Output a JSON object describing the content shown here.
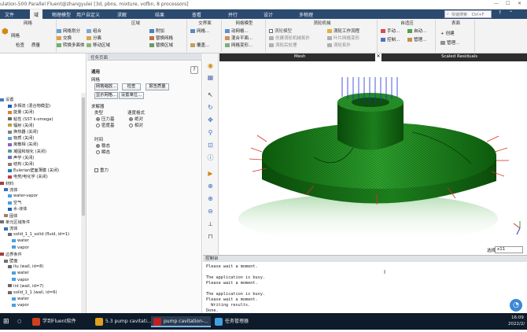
{
  "window": {
    "title": "ulation-500 Parallel Fluent@zhangyulei [3d, pbns, mixture, vofbn, 8 processors]"
  },
  "ribbon_tabs": [
    "文件",
    "域",
    "物理模型",
    "用户自定义",
    "求解",
    "结果",
    "查看",
    "并行",
    "设计",
    "多物理"
  ],
  "ribbon_tab_active": "域",
  "ribbon_search": {
    "placeholder": "快速搜索",
    "shortcut": "Ctrl+F"
  },
  "ribbon_groups": [
    {
      "title": "网格",
      "items": [
        "网格",
        "检查",
        "质量",
        "网格划分",
        "交换",
        "转换多面体"
      ]
    },
    {
      "title": "区域",
      "items": [
        "组合",
        "分离",
        "附加",
        "删除",
        "移动区域",
        "修改区域"
      ]
    },
    {
      "title": "区域",
      "items": [
        "附加",
        "替换网格",
        "替换区域",
        "删除"
      ]
    },
    {
      "title": "交界面",
      "items": [
        "网格...",
        "覆盖..."
      ]
    },
    {
      "title": "网格模型",
      "items": [
        "动网格...",
        "混合平面...",
        "网格变形..."
      ]
    },
    {
      "title": "涡轮机械",
      "items": [
        "涡轮模型",
        "创建涡轮机械拓扑",
        "涡轮后处理",
        "涡轮工作流程",
        "叶片网格变形",
        "涡轮拓扑"
      ]
    },
    {
      "title": "自适应",
      "items": [
        "手动...",
        "自动...",
        "控制...",
        "管理..."
      ]
    },
    {
      "title": "表面",
      "items": [
        "创建",
        "管理..."
      ]
    }
  ],
  "tree": [
    "设置",
    "多相流 (混合物模型)",
    "能量 (关闭)",
    "粘性 (SST k-omega)",
    "辐射 (关闭)",
    "换热器 (关闭)",
    "物质 (关闭)",
    "离散相 (关闭)",
    "凝固和熔化 (关闭)",
    "声学 (关闭)",
    "结构 (关闭)",
    "Eulerian壁面薄膜 (关闭)",
    "电势/电化学 (关闭)",
    "材料",
    "流体",
    "water-vapor",
    "空气",
    "水-液体",
    "固体",
    "单元区域条件",
    "流体",
    "solid_1_1_solid (fluid, id=1)",
    "water",
    "vapor",
    "边界条件",
    "壁面",
    "itu (wall, id=8)",
    "water",
    "vapor",
    "int (wall, id=7)",
    "solid_1_1 (wall, id=6)",
    "water",
    "vapor"
  ],
  "task_page": {
    "header": "任务页面",
    "section_general": "通用",
    "grid_label": "网格",
    "grid_buttons": [
      "网格缩放...",
      "检查",
      "报告质量",
      "显示网格...",
      "设置单位..."
    ],
    "solver_label": "求解器",
    "type_label": "类型",
    "type_options": [
      "压力基",
      "密度基"
    ],
    "type_selected": "压力基",
    "velocity_label": "速度格式",
    "velocity_options": [
      "绝对",
      "相对"
    ],
    "velocity_selected": "绝对",
    "time_label": "时间",
    "time_options": [
      "稳态",
      "瞬态"
    ],
    "time_selected": "稳态",
    "gravity_label": "重力"
  },
  "viewport_tabs": [
    "Mesh",
    "Scaled Residuals"
  ],
  "selection_label": "选择",
  "selection_value": "x11",
  "console": {
    "header": "控制台",
    "lines": [
      "Please wait a moment.",
      "",
      "The application is busy.",
      "Please wait a moment.",
      "",
      "The application is busy.",
      "Please wait a moment.",
      "  Writing results.",
      "Done."
    ]
  },
  "taskbar": {
    "apps": [
      "学到Fluent软件",
      "5.3 pump cavitati...",
      "pump cavitation-...",
      "任务管理器"
    ],
    "time": "16:09",
    "date": "2022/2/"
  },
  "colors": {
    "ribbon_bg": "#2b4a70",
    "mesh_green": "#1f8a1f",
    "taskbar_bg": "#0d1b2a",
    "arrow_blue": "#1f2fd0",
    "arrow_red": "#e03020"
  }
}
